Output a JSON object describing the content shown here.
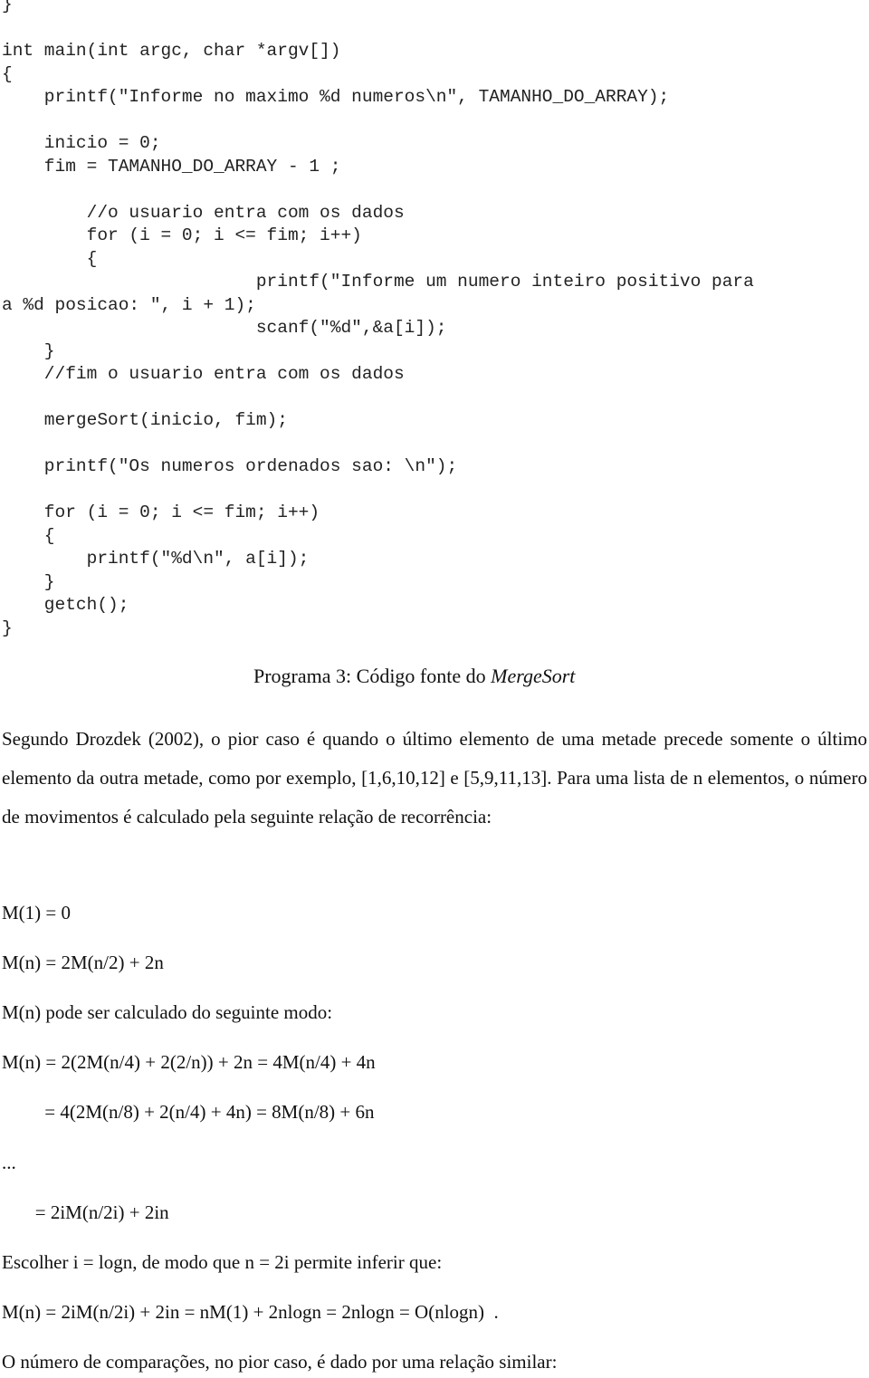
{
  "code_block": {
    "lines": [
      "}",
      "",
      "int main(int argc, char *argv[])",
      "{",
      "    printf(\"Informe no maximo %d numeros\\n\", TAMANHO_DO_ARRAY);",
      "",
      "    inicio = 0;",
      "    fim = TAMANHO_DO_ARRAY - 1 ;",
      "",
      "        //o usuario entra com os dados",
      "        for (i = 0; i <= fim; i++)",
      "        {",
      "                        printf(\"Informe um numero inteiro positivo para",
      "a %d posicao: \", i + 1);",
      "                        scanf(\"%d\",&a[i]);",
      "    }",
      "    //fim o usuario entra com os dados",
      "",
      "    mergeSort(inicio, fim);",
      "",
      "    printf(\"Os numeros ordenados sao: \\n\");",
      "",
      "    for (i = 0; i <= fim; i++)",
      "    {",
      "        printf(\"%d\\n\", a[i]);",
      "    }",
      "    getch();",
      "}"
    ]
  },
  "caption": {
    "prefix": "Programa 3: Código fonte do ",
    "italic": "MergeSort"
  },
  "paragraph": "Segundo Drozdek (2002), o pior caso é quando o último elemento de uma metade precede somente o último elemento da outra metade, como por exemplo, [1,6,10,12] e [5,9,11,13]. Para uma lista de n elementos, o número de movimentos é calculado pela seguinte relação de recorrência:",
  "equations": [
    "M(1) = 0",
    "M(n) = 2M(n/2) + 2n",
    "M(n) pode ser calculado do seguinte modo:",
    "M(n) = 2(2M(n/4) + 2(2/n)) + 2n = 4M(n/4) + 4n",
    "         = 4(2M(n/8) + 2(n/4) + 4n) = 8M(n/8) + 6n",
    "...",
    "       = 2iM(n/2i) + 2in",
    "Escolher i = logn, de modo que n = 2i permite inferir que:",
    "M(n) = 2iM(n/2i) + 2in = nM(1) + 2nlogn = 2nlogn = O(nlogn)  .",
    "O número de comparações, no pior caso, é dado por uma relação similar:"
  ]
}
